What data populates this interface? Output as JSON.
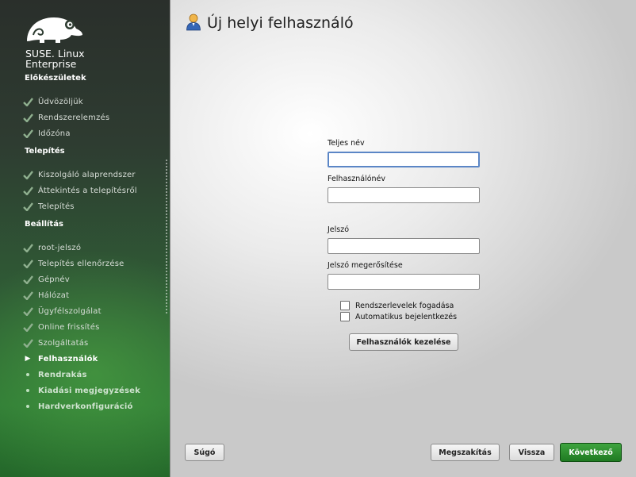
{
  "brand": {
    "line1": "SUSE. Linux",
    "line2": "Enterprise"
  },
  "sidebar": {
    "sections": [
      {
        "title": "Előkészületek",
        "steps": [
          {
            "label": "Üdvözöljük",
            "state": "done"
          },
          {
            "label": "Rendszerelemzés",
            "state": "done"
          },
          {
            "label": "Időzóna",
            "state": "done"
          }
        ]
      },
      {
        "title": "Telepítés",
        "steps": [
          {
            "label": "Kiszolgáló alaprendszer",
            "state": "done"
          },
          {
            "label": "Áttekintés a telepítésről",
            "state": "done"
          },
          {
            "label": "Telepítés",
            "state": "done"
          }
        ]
      },
      {
        "title": "Beállítás",
        "steps": [
          {
            "label": "root-jelszó",
            "state": "done"
          },
          {
            "label": "Telepítés ellenőrzése",
            "state": "done"
          },
          {
            "label": "Gépnév",
            "state": "done"
          },
          {
            "label": "Hálózat",
            "state": "done"
          },
          {
            "label": "Ügyfélszolgálat",
            "state": "done"
          },
          {
            "label": "Online frissítés",
            "state": "done"
          },
          {
            "label": "Szolgáltatás",
            "state": "done"
          },
          {
            "label": "Felhasználók",
            "state": "current"
          },
          {
            "label": "Rendrakás",
            "state": "todo"
          },
          {
            "label": "Kiadási megjegyzések",
            "state": "todo"
          },
          {
            "label": "Hardverkonfiguráció",
            "state": "todo"
          }
        ]
      }
    ]
  },
  "main": {
    "title": "Új helyi felhasználó",
    "title_icon": "user-icon",
    "fields": {
      "full_name": {
        "label": "Teljes név",
        "value": ""
      },
      "username": {
        "label": "Felhasználónév",
        "value": ""
      },
      "password": {
        "label": "Jelszó",
        "value": ""
      },
      "password_confirm": {
        "label": "Jelszó megerősítése",
        "value": ""
      }
    },
    "checkboxes": {
      "receive_mail": {
        "label": "Rendszerlevelek fogadása",
        "checked": false
      },
      "auto_login": {
        "label": "Automatikus bejelentkezés",
        "checked": false
      }
    },
    "manage_users_button": "Felhasználók kezelése"
  },
  "footer": {
    "help": "Súgó",
    "abort": "Megszakítás",
    "back": "Vissza",
    "next": "Következő"
  },
  "colors": {
    "accent_green": "#2a8a2e",
    "focus_blue": "#5b86c6"
  }
}
